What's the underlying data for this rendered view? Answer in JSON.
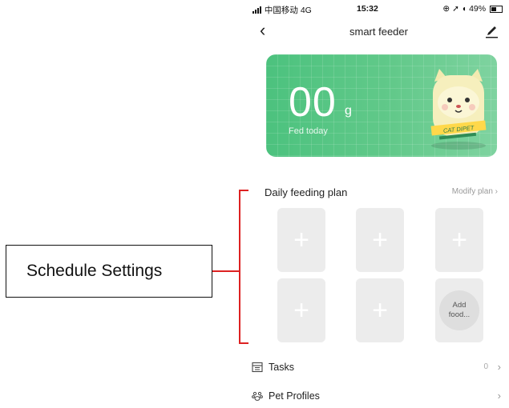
{
  "annotation": {
    "label": "Schedule Settings",
    "accent_color": "#dd2222"
  },
  "status_bar": {
    "carrier": "中国移动 4G",
    "time": "15:32",
    "right": "49%"
  },
  "nav": {
    "title": "smart feeder",
    "back_icon": "chevron-left-icon",
    "edit_icon": "edit-icon"
  },
  "hero": {
    "amount": "00",
    "unit": "g",
    "label": "Fed today",
    "mascot_tag": "CAT DIPET",
    "gradient_colors": [
      "#4cc27e",
      "#7fd3a0"
    ]
  },
  "plan": {
    "title": "Daily feeding plan",
    "modify_label": "Modify plan",
    "slots": [
      {
        "type": "empty",
        "symbol": "+"
      },
      {
        "type": "empty",
        "symbol": "+"
      },
      {
        "type": "empty",
        "symbol": "+"
      },
      {
        "type": "empty",
        "symbol": "+"
      },
      {
        "type": "empty",
        "symbol": "+"
      },
      {
        "type": "add",
        "label_line1": "Add",
        "label_line2": "food..."
      }
    ]
  },
  "menu": {
    "tasks": {
      "label": "Tasks",
      "count": "0",
      "icon": "calendar-icon"
    },
    "pet_profiles": {
      "label": "Pet Profiles",
      "icon": "paw-icon"
    }
  }
}
